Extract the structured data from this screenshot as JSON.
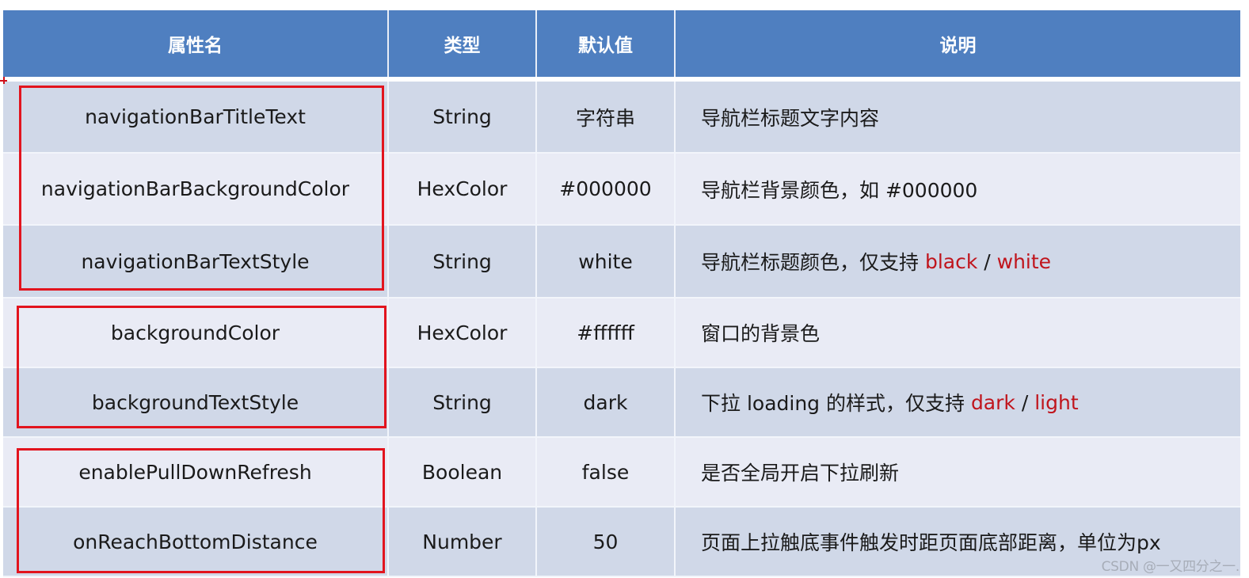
{
  "table": {
    "headers": {
      "name": "属性名",
      "type": "类型",
      "default": "默认值",
      "description": "说明"
    },
    "rows": [
      {
        "name": "navigationBarTitleText",
        "type": "String",
        "default": "字符串",
        "description": "导航栏标题文字内容"
      },
      {
        "name": "navigationBarBackgroundColor",
        "type": "HexColor",
        "default": "#000000",
        "description": "导航栏背景颜色，如 #000000"
      },
      {
        "name": "navigationBarTextStyle",
        "type": "String",
        "default": "white",
        "description": "导航栏标题颜色，仅支持 ",
        "options": [
          "black",
          "white"
        ],
        "separator": " / "
      },
      {
        "name": "backgroundColor",
        "type": "HexColor",
        "default": "#ffffff",
        "description": "窗口的背景色"
      },
      {
        "name": "backgroundTextStyle",
        "type": "String",
        "default": "dark",
        "description": "下拉 loading 的样式，仅支持 ",
        "options": [
          "dark",
          "light"
        ],
        "separator": " / "
      },
      {
        "name": "enablePullDownRefresh",
        "type": "Boolean",
        "default": "false",
        "description": "是否全局开启下拉刷新"
      },
      {
        "name": "onReachBottomDistance",
        "type": "Number",
        "default": "50",
        "description": "页面上拉触底事件触发时距页面底部距离，单位为px"
      }
    ]
  },
  "highlight_groups": [
    [
      "navigationBarTitleText",
      "navigationBarBackgroundColor",
      "navigationBarTextStyle"
    ],
    [
      "backgroundColor",
      "backgroundTextStyle"
    ],
    [
      "enablePullDownRefresh",
      "onReachBottomDistance"
    ]
  ],
  "watermark": "CSDN @一又四分之一.",
  "colors": {
    "header_bg": "#4f7fc0",
    "row_dark": "#d0d8e8",
    "row_light": "#e9ebf5",
    "highlight_border": "#e2141e",
    "option_text": "#c0141c"
  }
}
